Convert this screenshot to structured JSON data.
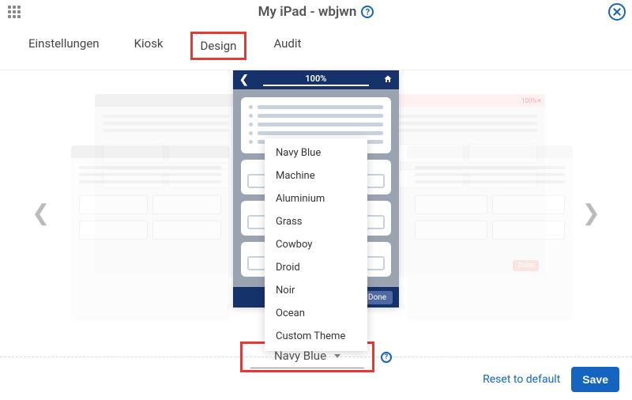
{
  "header": {
    "title": "My iPad - wbjwn"
  },
  "tabs": [
    {
      "label": "Einstellungen"
    },
    {
      "label": "Kiosk"
    },
    {
      "label": "Design"
    },
    {
      "label": "Audit"
    }
  ],
  "active_tab_index": 2,
  "preview": {
    "progress": "100%",
    "done_label": "Done",
    "thumb_done": "Done",
    "thumb_pct": "100%"
  },
  "theme_dropdown": {
    "options": [
      "Navy Blue",
      "Machine",
      "Aluminium",
      "Grass",
      "Cowboy",
      "Droid",
      "Noir",
      "Ocean",
      "Custom Theme"
    ],
    "selected": "Navy Blue"
  },
  "footer": {
    "reset": "Reset to default",
    "save": "Save"
  }
}
